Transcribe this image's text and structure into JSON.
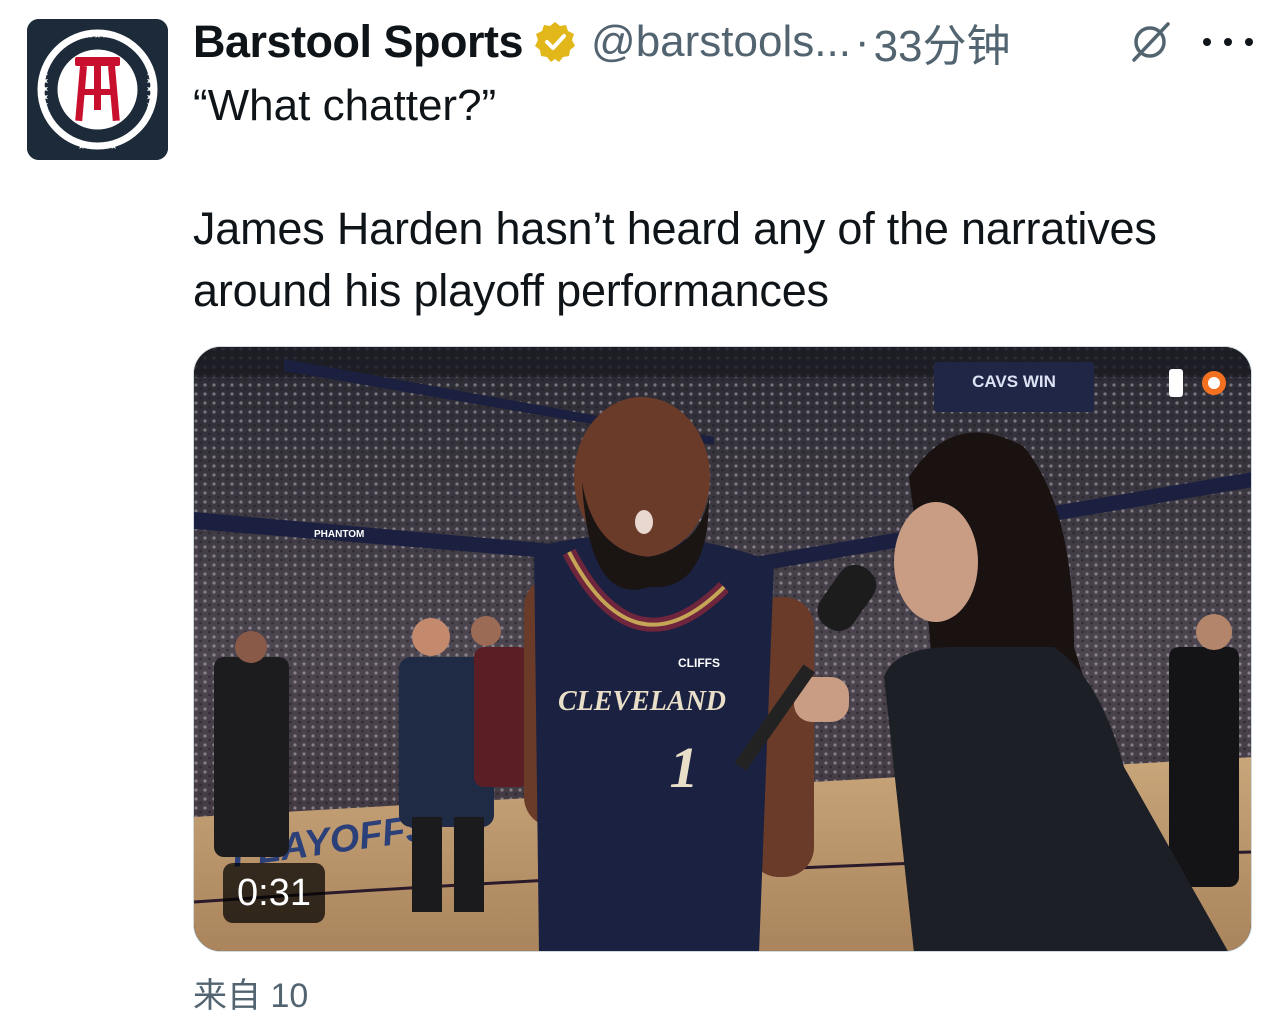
{
  "tweet": {
    "author_name": "Barstool Sports",
    "handle": "@barstools...",
    "separator": "·",
    "time": "33分钟",
    "quote": "“What chatter?”",
    "body": "James Harden hasn’t heard any of the narratives around his playoff performances",
    "source": "来自 10"
  },
  "video": {
    "duration": "0:31",
    "scoreboard_text": "CAVS WIN",
    "banner_text": "PHANTOM",
    "jersey_team": "CLEVELAND",
    "jersey_number": "1",
    "jersey_patch": "CLIFFS",
    "court_text": "PLAYOFFS"
  },
  "icons": {
    "avatar": "barstool-logo-icon",
    "verified": "verified-badge-icon",
    "grok": "grok-icon",
    "more": "more-icon"
  },
  "colors": {
    "avatar_bg": "#1d2a3a",
    "logo_red": "#c8102e",
    "verified_gold": "#e2b719",
    "muted_text": "#536471",
    "jersey_navy": "#1b2140",
    "jersey_wine": "#6f263d",
    "jersey_gold": "#c5a657"
  }
}
